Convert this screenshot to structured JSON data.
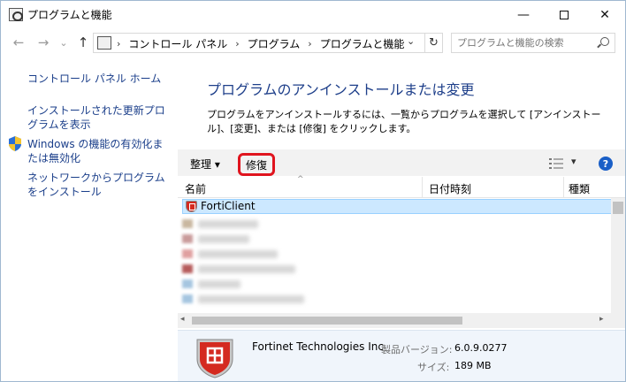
{
  "window": {
    "title": "プログラムと機能",
    "minimize": "—",
    "close": "✕"
  },
  "nav": {
    "back": "←",
    "forward": "→",
    "recent": "⌄",
    "up": "↑",
    "breadcrumbs": [
      "コントロール パネル",
      "プログラム",
      "プログラムと機能"
    ],
    "separator": "›",
    "dropdown": "⌄",
    "refresh": "↻",
    "search_placeholder": "プログラムと機能の検索"
  },
  "sidebar": {
    "home": "コントロール パネル ホーム",
    "updates": "インストールされた更新プログラムを表示",
    "features": "Windows の機能の有効化または無効化",
    "net_install": "ネットワークからプログラムをインストール"
  },
  "main": {
    "heading": "プログラムのアンインストールまたは変更",
    "description": "プログラムをアンインストールするには、一覧からプログラムを選択して [アンインストール]、[変更]、または [修復] をクリックします。"
  },
  "toolbar": {
    "organize": "整理 ▾",
    "repair": "修復",
    "view_dropdown": "▾",
    "help": "?"
  },
  "list": {
    "columns": [
      "名前",
      "日付時刻",
      "種類"
    ],
    "sort_indicator": "^",
    "selected_item": "FortiClient"
  },
  "details": {
    "publisher": "Fortinet Technologies Inc",
    "version_label": "製品バージョン:",
    "version_value": "6.0.9.0277",
    "size_label": "サイズ:",
    "size_value": "189 MB"
  },
  "scroll": {
    "left": "◂",
    "right": "▸"
  },
  "colors": {
    "link": "#1a3e8a",
    "heading": "#1e3f8a",
    "selection": "#cce8ff",
    "highlight_border": "#e0141e"
  }
}
